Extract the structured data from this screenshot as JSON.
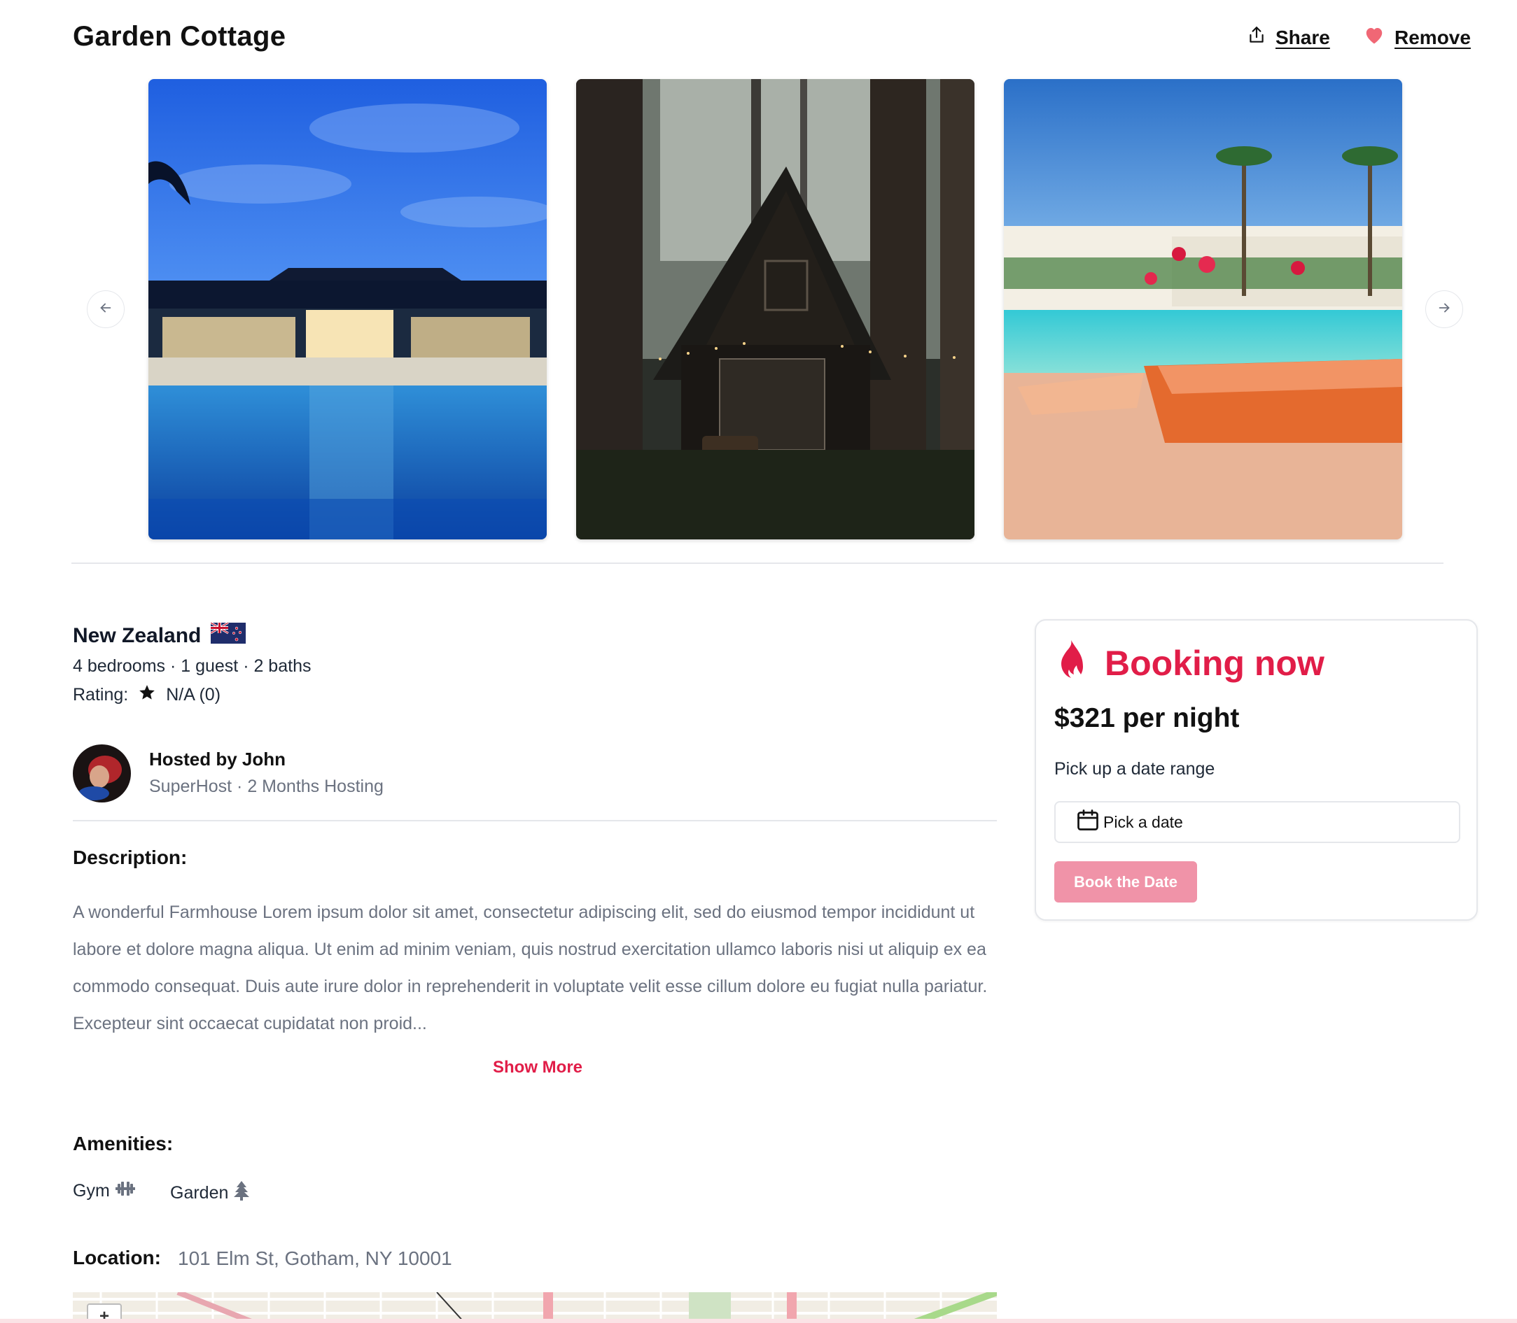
{
  "listing": {
    "title": "Garden Cottage",
    "share_label": "Share",
    "remove_label": "Remove",
    "country": "New Zealand",
    "stats": "4 bedrooms · 1 guest · 2 baths",
    "rating_label": "Rating:",
    "rating_value": "N/A (0)"
  },
  "host": {
    "name": "Hosted by John",
    "subtitle": "SuperHost · 2 Months Hosting"
  },
  "description": {
    "heading": "Description:",
    "text": "A wonderful Farmhouse Lorem ipsum dolor sit amet, consectetur adipiscing elit, sed do eiusmod tempor incididunt ut labore et dolore magna aliqua. Ut enim ad minim veniam, quis nostrud exercitation ullamco laboris nisi ut aliquip ex ea commodo consequat. Duis aute irure dolor in reprehenderit in voluptate velit esse cillum dolore eu fugiat nulla pariatur. Excepteur sint occaecat cupidatat non proid...",
    "show_more": "Show More"
  },
  "amenities": {
    "heading": "Amenities:",
    "items": [
      {
        "label": "Gym",
        "icon": "dumbbell-icon"
      },
      {
        "label": "Garden",
        "icon": "tree-icon"
      }
    ]
  },
  "location": {
    "heading": "Location:",
    "address": "101 Elm St, Gotham, NY 10001"
  },
  "booking": {
    "title": "Booking now",
    "price": "$321 per night",
    "range_label": "Pick up a date range",
    "date_placeholder": "Pick a date",
    "button_label": "Book the Date"
  },
  "colors": {
    "accent": "#e11d48",
    "button_disabled": "#f093a8",
    "heart": "#f06775"
  }
}
